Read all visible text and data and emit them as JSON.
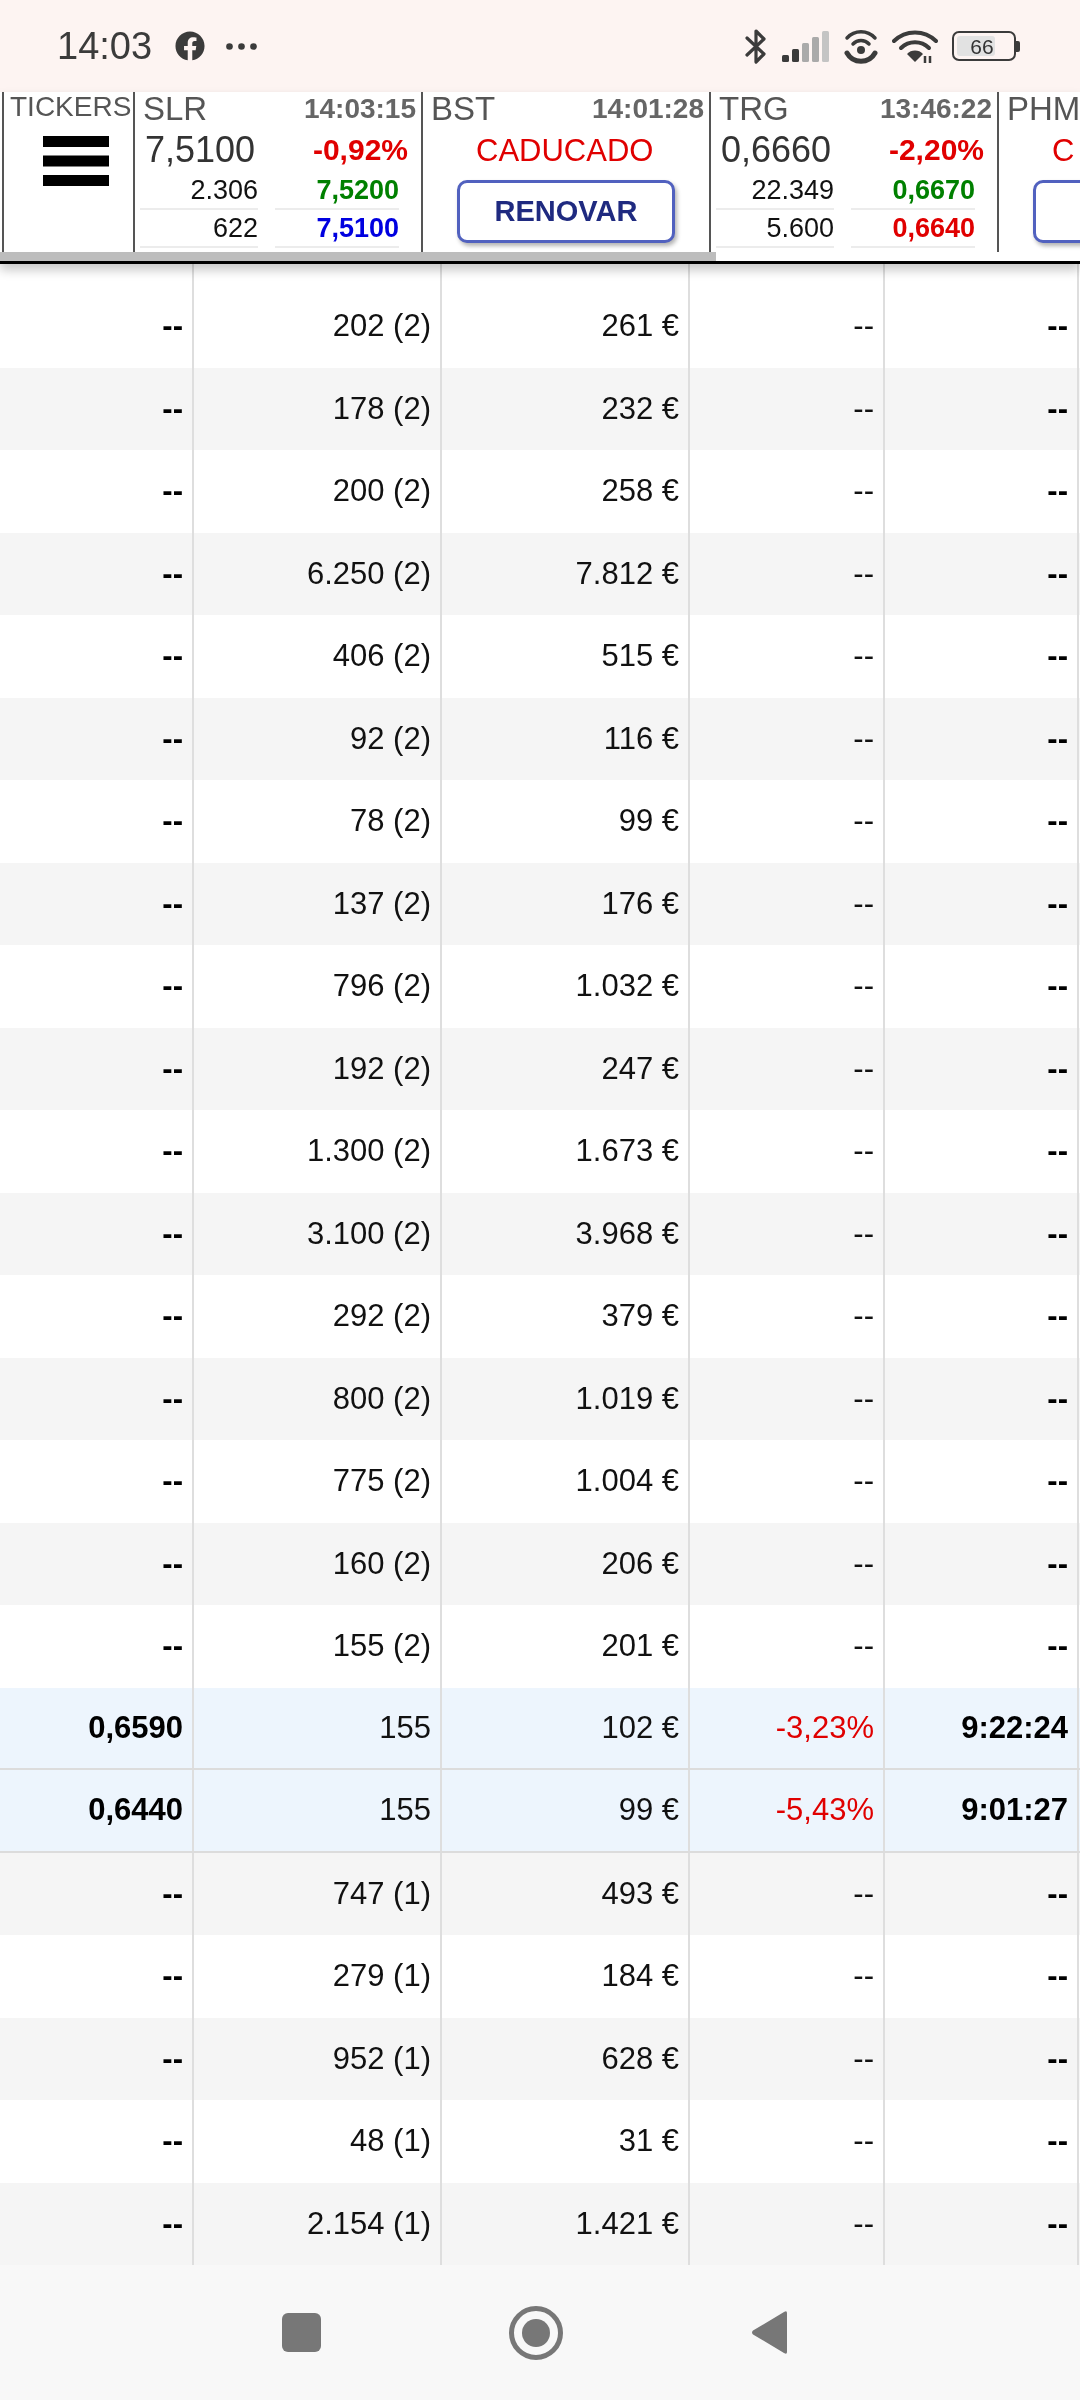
{
  "status_bar": {
    "time": "14:03",
    "battery": "66"
  },
  "tickers_panel": {
    "label": "TICKERS"
  },
  "tickers": [
    {
      "kind": "quote",
      "symbol": "SLR",
      "time": "14:03:15",
      "price": "7,5100",
      "change": {
        "value": "-0,92%",
        "color": "#e00000"
      },
      "bid": {
        "volume": "2.306",
        "price": "7,5200",
        "color": "#008000"
      },
      "ask": {
        "volume": "622",
        "price": "7,5100",
        "color": "#0000e0"
      }
    },
    {
      "kind": "expired",
      "symbol": "BST",
      "time": "14:01:28",
      "status": "CADUCADO",
      "button": "RENOVAR"
    },
    {
      "kind": "quote",
      "symbol": "TRG",
      "time": "13:46:22",
      "price": "0,6660",
      "change": {
        "value": "-2,20%",
        "color": "#e00000"
      },
      "bid": {
        "volume": "22.349",
        "price": "0,6670",
        "color": "#008000"
      },
      "ask": {
        "volume": "5.600",
        "price": "0,6640",
        "color": "#e00000"
      }
    },
    {
      "kind": "expired",
      "symbol": "PHM",
      "status": "C"
    }
  ],
  "table": {
    "rows": [
      {
        "highlighted": false,
        "cells": [
          "--",
          "202 (2)",
          "261 €",
          "--",
          "--"
        ]
      },
      {
        "highlighted": false,
        "cells": [
          "--",
          "178 (2)",
          "232 €",
          "--",
          "--"
        ]
      },
      {
        "highlighted": false,
        "cells": [
          "--",
          "200 (2)",
          "258 €",
          "--",
          "--"
        ]
      },
      {
        "highlighted": false,
        "cells": [
          "--",
          "6.250 (2)",
          "7.812 €",
          "--",
          "--"
        ]
      },
      {
        "highlighted": false,
        "cells": [
          "--",
          "406 (2)",
          "515 €",
          "--",
          "--"
        ]
      },
      {
        "highlighted": false,
        "cells": [
          "--",
          "92 (2)",
          "116 €",
          "--",
          "--"
        ]
      },
      {
        "highlighted": false,
        "cells": [
          "--",
          "78 (2)",
          "99 €",
          "--",
          "--"
        ]
      },
      {
        "highlighted": false,
        "cells": [
          "--",
          "137 (2)",
          "176 €",
          "--",
          "--"
        ]
      },
      {
        "highlighted": false,
        "cells": [
          "--",
          "796 (2)",
          "1.032 €",
          "--",
          "--"
        ]
      },
      {
        "highlighted": false,
        "cells": [
          "--",
          "192 (2)",
          "247 €",
          "--",
          "--"
        ]
      },
      {
        "highlighted": false,
        "cells": [
          "--",
          "1.300 (2)",
          "1.673 €",
          "--",
          "--"
        ]
      },
      {
        "highlighted": false,
        "cells": [
          "--",
          "3.100 (2)",
          "3.968 €",
          "--",
          "--"
        ]
      },
      {
        "highlighted": false,
        "cells": [
          "--",
          "292 (2)",
          "379 €",
          "--",
          "--"
        ]
      },
      {
        "highlighted": false,
        "cells": [
          "--",
          "800 (2)",
          "1.019 €",
          "--",
          "--"
        ]
      },
      {
        "highlighted": false,
        "cells": [
          "--",
          "775 (2)",
          "1.004 €",
          "--",
          "--"
        ]
      },
      {
        "highlighted": false,
        "cells": [
          "--",
          "160 (2)",
          "206 €",
          "--",
          "--"
        ]
      },
      {
        "highlighted": false,
        "cells": [
          "--",
          "155 (2)",
          "201 €",
          "--",
          "--"
        ]
      },
      {
        "highlighted": true,
        "color": "#e00000",
        "cells": [
          "0,6590",
          "155",
          "102 €",
          "-3,23%",
          "9:22:24"
        ]
      },
      {
        "highlighted": true,
        "color": "#e00000",
        "cells": [
          "0,6440",
          "155",
          "99 €",
          "-5,43%",
          "9:01:27"
        ]
      },
      {
        "highlighted": false,
        "cells": [
          "--",
          "747 (1)",
          "493 €",
          "--",
          "--"
        ]
      },
      {
        "highlighted": false,
        "cells": [
          "--",
          "279 (1)",
          "184 €",
          "--",
          "--"
        ]
      },
      {
        "highlighted": false,
        "cells": [
          "--",
          "952 (1)",
          "628 €",
          "--",
          "--"
        ]
      },
      {
        "highlighted": false,
        "cells": [
          "--",
          "48 (1)",
          "31 €",
          "--",
          "--"
        ]
      },
      {
        "highlighted": false,
        "cells": [
          "--",
          "2.154 (1)",
          "1.421 €",
          "--",
          "--"
        ]
      }
    ]
  }
}
